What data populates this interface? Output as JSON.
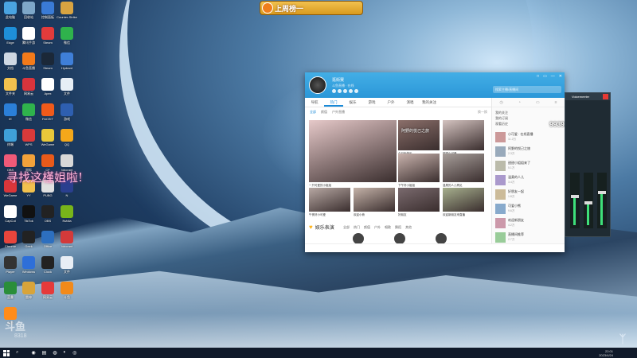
{
  "banner": {
    "text": "上周榜一"
  },
  "overlay": {
    "streamer_text": "寻找这槿姐啦!",
    "room_id": "9939314",
    "watermark": "斗鱼",
    "watermark_sub": "8318"
  },
  "desktop_icons": [
    {
      "label": "此电脑",
      "color": "#4aa3e0"
    },
    {
      "label": "回收站",
      "color": "#7ea7c8"
    },
    {
      "label": "控制面板",
      "color": "#3a7bd5"
    },
    {
      "label": "Counter-Strike",
      "color": "#d9a441"
    },
    {
      "label": "Edge",
      "color": "#1e8fd9"
    },
    {
      "label": "腾讯手游",
      "color": "#ffffff"
    },
    {
      "label": "Steam",
      "color": "#e23b3b"
    },
    {
      "label": "微信",
      "color": "#2fb24c"
    },
    {
      "label": "文档",
      "color": "#cfd8e3"
    },
    {
      "label": "斗鱼直播",
      "color": "#f27a1a"
    },
    {
      "label": "Steam",
      "color": "#1b2838"
    },
    {
      "label": "Hydrant",
      "color": "#3f7fd8"
    },
    {
      "label": "文件夹",
      "color": "#f2c14e"
    },
    {
      "label": "网易云",
      "color": "#d9343c"
    },
    {
      "label": "Apex",
      "color": "#ffffff"
    },
    {
      "label": "文件",
      "color": "#e7eef5"
    },
    {
      "label": "IE",
      "color": "#2b7fd8"
    },
    {
      "label": "微信",
      "color": "#2fb24c"
    },
    {
      "label": "FACEIT",
      "color": "#f05a1a"
    },
    {
      "label": "游戏",
      "color": "#2e5fb0"
    },
    {
      "label": "终端",
      "color": "#3fa0d8"
    },
    {
      "label": "WPS",
      "color": "#d83a3a"
    },
    {
      "label": "WeGame",
      "color": "#e8c83a"
    },
    {
      "label": "QQ",
      "color": "#f4a81a"
    },
    {
      "label": "OBS",
      "color": "#f05a78"
    },
    {
      "label": "鼠标",
      "color": "#f2a23a"
    },
    {
      "label": "CF",
      "color": "#e85a1a"
    },
    {
      "label": "Valorant",
      "color": "#d8d8d8"
    },
    {
      "label": "WeGame",
      "color": "#d9363a"
    },
    {
      "label": "YY",
      "color": "#f2c14e"
    },
    {
      "label": "PUBG",
      "color": "#e0e0e0"
    },
    {
      "label": "N",
      "color": "#2a3f8f"
    },
    {
      "label": "CapCut",
      "color": "#ffffff"
    },
    {
      "label": "TikTok",
      "color": "#111111"
    },
    {
      "label": "OBS",
      "color": "#222222"
    },
    {
      "label": "Nvidia",
      "color": "#78b51a"
    },
    {
      "label": "Chrome",
      "color": "#e8453c"
    },
    {
      "label": "Geek",
      "color": "#222222"
    },
    {
      "label": "Office",
      "color": "#2d6fbf"
    },
    {
      "label": "Valorant",
      "color": "#d33a3a"
    },
    {
      "label": "Player",
      "color": "#333333"
    },
    {
      "label": "Windows",
      "color": "#2e6fd8"
    },
    {
      "label": "Clock",
      "color": "#222222"
    },
    {
      "label": "文件",
      "color": "#e8eef5"
    },
    {
      "label": "蓝叠",
      "color": "#2a8e3a"
    },
    {
      "label": "雷神",
      "color": "#d8a43a"
    },
    {
      "label": "网易云",
      "color": "#e53a3a"
    },
    {
      "label": "斗鱼",
      "color": "#f28a1a"
    },
    {
      "label": "斗鱼",
      "color": "#ff8c1a"
    }
  ],
  "app": {
    "username": "逛街赛",
    "subline": "斗鱼直播 · 在线",
    "search_placeholder": "搜索主播/直播间",
    "window_controls": [
      "□",
      "▭",
      "—",
      "✕"
    ],
    "tabs": [
      "导航",
      "热门",
      "娱乐",
      "游戏",
      "户外",
      "演唱",
      "我的关注"
    ],
    "active_tab": 1,
    "subtabs": [
      "全部",
      "颜值",
      "户外直播"
    ],
    "refresh": "换一换",
    "tiles": [
      {
        "caption": "一只可爱的小姐姐",
        "overlay": "",
        "color": "#e6c9c9"
      },
      {
        "caption": "今日份快乐",
        "overlay": "阿野的悦己之旅",
        "color": "#8b6f6a"
      },
      {
        "caption": "甜甜小可爱",
        "overlay": "",
        "color": "#d4c3c0"
      },
      {
        "caption": "下午好小姐姐",
        "overlay": "",
        "color": "#c9b3ad"
      },
      {
        "caption": "温柔的人儿再见",
        "overlay": "",
        "color": "#a79e9a"
      },
      {
        "caption": "午夜好小可爱",
        "overlay": "",
        "color": "#b7a8a3"
      },
      {
        "caption": "欢迎小熊",
        "overlay": "",
        "color": "#c4b2a8"
      },
      {
        "caption": "好朋友",
        "overlay": "",
        "color": "#7a6a6e"
      },
      {
        "caption": "欢迎新朋友来直播",
        "overlay": "",
        "color": "#a7b08e"
      },
      {
        "caption": "可爱的主播姐姐",
        "overlay": "",
        "color": "#c8b0a9"
      }
    ],
    "ent_title": "娱乐表演",
    "ent_tabs": [
      "全部",
      "热门",
      "颜值",
      "户外",
      "唱歌",
      "舞蹈",
      "其他"
    ],
    "right_links": [
      "我的关注",
      "我的订阅",
      "观看历史"
    ],
    "friends": [
      {
        "name": "小可爱 · 在线直播",
        "status": "11.2万"
      },
      {
        "name": "阿野的悦己之旅",
        "status": "2.3万"
      },
      {
        "name": "甜甜小姐姐来了",
        "status": "5.1万"
      },
      {
        "name": "温柔的人儿",
        "status": "3.4万"
      },
      {
        "name": "好朋友一起",
        "status": "1.8万"
      },
      {
        "name": "可爱小熊",
        "status": "9.6万"
      },
      {
        "name": "欢迎新朋友",
        "status": "4.2万"
      },
      {
        "name": "直播间推荐",
        "status": "2.7万"
      }
    ]
  },
  "mixer": {
    "title": "Voicemeeter",
    "levels": [
      0.62,
      0.48,
      0.7
    ]
  },
  "taskbar": {
    "search_icon": "search-icon",
    "time": "22:01",
    "date": "2023/4/24",
    "lang": "英",
    "apps": [
      "chrome-icon",
      "explorer-icon",
      "steam-icon",
      "douyu-icon",
      "obs-icon"
    ]
  }
}
